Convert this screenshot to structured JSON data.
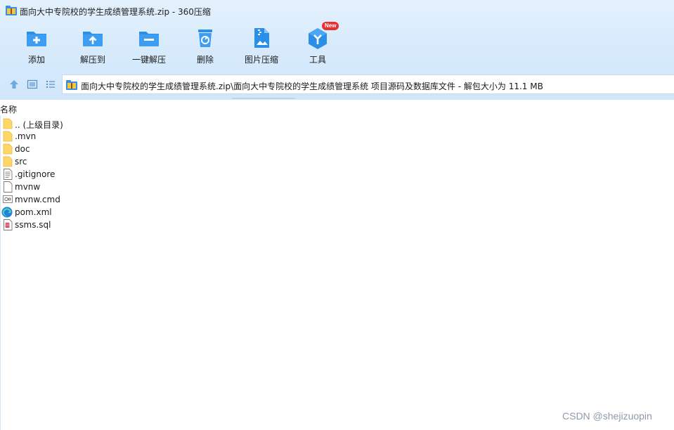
{
  "window": {
    "title": "面向大中专院校的学生成绩管理系统.zip - 360压缩"
  },
  "toolbar": {
    "items": [
      {
        "label": "添加",
        "icon": "add-folder-icon"
      },
      {
        "label": "解压到",
        "icon": "extract-to-icon"
      },
      {
        "label": "一键解压",
        "icon": "one-click-extract-icon"
      },
      {
        "label": "删除",
        "icon": "delete-trash-icon"
      },
      {
        "label": "图片压缩",
        "icon": "image-compress-icon"
      },
      {
        "label": "工具",
        "icon": "tools-cube-icon",
        "badge": "New"
      }
    ]
  },
  "nav": {
    "path": "面向大中专院校的学生成绩管理系统.zip\\面向大中专院校的学生成绩管理系统 项目源码及数据库文件 - 解包大小为 11.1 MB"
  },
  "list": {
    "column_name": "名称",
    "files": [
      {
        "name": ".. (上级目录)",
        "icon": "folder-icon"
      },
      {
        "name": ".mvn",
        "icon": "folder-icon"
      },
      {
        "name": "doc",
        "icon": "folder-icon"
      },
      {
        "name": "src",
        "icon": "folder-icon"
      },
      {
        "name": ".gitignore",
        "icon": "text-file-icon"
      },
      {
        "name": "mvnw",
        "icon": "blank-file-icon"
      },
      {
        "name": "mvnw.cmd",
        "icon": "cmd-file-icon"
      },
      {
        "name": "pom.xml",
        "icon": "edge-browser-icon"
      },
      {
        "name": "ssms.sql",
        "icon": "sql-file-icon"
      }
    ]
  },
  "watermark": "CSDN @shejizuopin",
  "colors": {
    "toolbar_bg": "#d8ebfc",
    "icon_blue": "#2b8fe8",
    "badge_red": "#e8312f",
    "folder_yellow": "#ffd766"
  }
}
